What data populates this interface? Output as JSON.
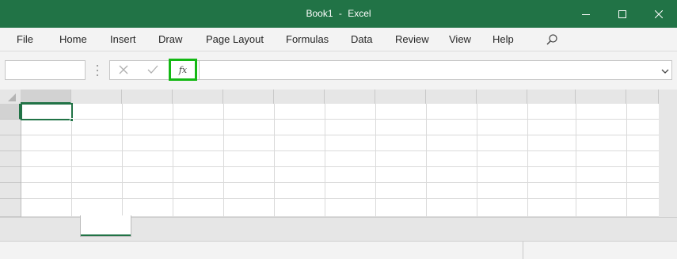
{
  "window": {
    "book_name": "Book1",
    "separator": "-",
    "app_name": "Excel"
  },
  "menu": {
    "items": [
      "File",
      "Home",
      "Insert",
      "Draw",
      "Page Layout",
      "Formulas",
      "Data",
      "Review",
      "View",
      "Help"
    ],
    "search_icon": "search-icon"
  },
  "formula_bar": {
    "name_box_value": "",
    "fx_label": "fx",
    "formula_value": ""
  },
  "sheet": {
    "tab_label": ""
  },
  "colors": {
    "title_bar": "#217346",
    "selection": "#217346",
    "highlight_box": "#14b814"
  }
}
